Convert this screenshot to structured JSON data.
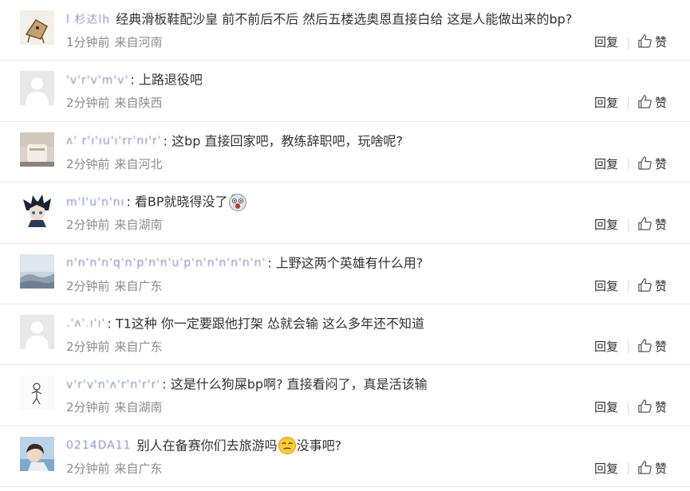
{
  "actions": {
    "reply_label": "回复",
    "like_label": "赞",
    "like_icon": "thumbs-up-icon"
  },
  "colors": {
    "username": "#8a93c9",
    "meta_text": "#8c8c8c",
    "body_text": "#333333",
    "divider": "#e8e8e8"
  },
  "comments": [
    {
      "username": "l 杉达lh",
      "colon": "",
      "text": "经典滑板鞋配沙皇 前不前后不后 然后五楼选奥恩直接白给 这是人能做出来的bp?",
      "time": "1分钟前",
      "location": "来自河南",
      "avatar": "cartoon-avatar"
    },
    {
      "username": "'v'r'v'm'v'",
      "colon": ":",
      "text": "上路退役吧",
      "time": "2分钟前",
      "location": "来自陕西",
      "avatar": "default-avatar"
    },
    {
      "username": "ʌ' r'ı'ıu'ı'rr'nı'r'",
      "colon": ":",
      "text": "这bp 直接回家吧，教练辞职吧，玩啥呢?",
      "time": "2分钟前",
      "location": "来自河北",
      "avatar": "photo-avatar"
    },
    {
      "username": "m'l'u'n'nı",
      "colon": ":",
      "text": "看BP就晓得没了",
      "emoji_after": "shocked-emoji",
      "time": "2分钟前",
      "location": "来自湖南",
      "avatar": "anime-avatar"
    },
    {
      "username": "n'n'n'n'q'n'p'n'n'u'p'n'n'n'n'n'n'",
      "colon": ":",
      "text": "上野这两个英雄有什么用?",
      "time": "2分钟前",
      "location": "来自广东",
      "avatar": "sky-avatar"
    },
    {
      "username": ".'ʌ'.ı'ı'",
      "colon": ":",
      "text": "T1这种 你一定要跟他打架 怂就会输 这么多年还不知道",
      "time": "2分钟前",
      "location": "来自广东",
      "avatar": "default-avatar"
    },
    {
      "username": "v'r'v'n'ʌ'r'n'r'r'",
      "colon": ":",
      "text": "这是什么狗屎bp啊? 直接看闷了，真是活该输",
      "time": "2分钟前",
      "location": "来自湖南",
      "avatar": "sketch-avatar"
    },
    {
      "username": "0214DA11",
      "colon": "",
      "text": "别人在备赛你们去旅游吗",
      "emoji_after": "smirk-emoji",
      "text_after": "没事吧?",
      "time": "2分钟前",
      "location": "来自广东",
      "avatar": "girl-avatar"
    }
  ]
}
